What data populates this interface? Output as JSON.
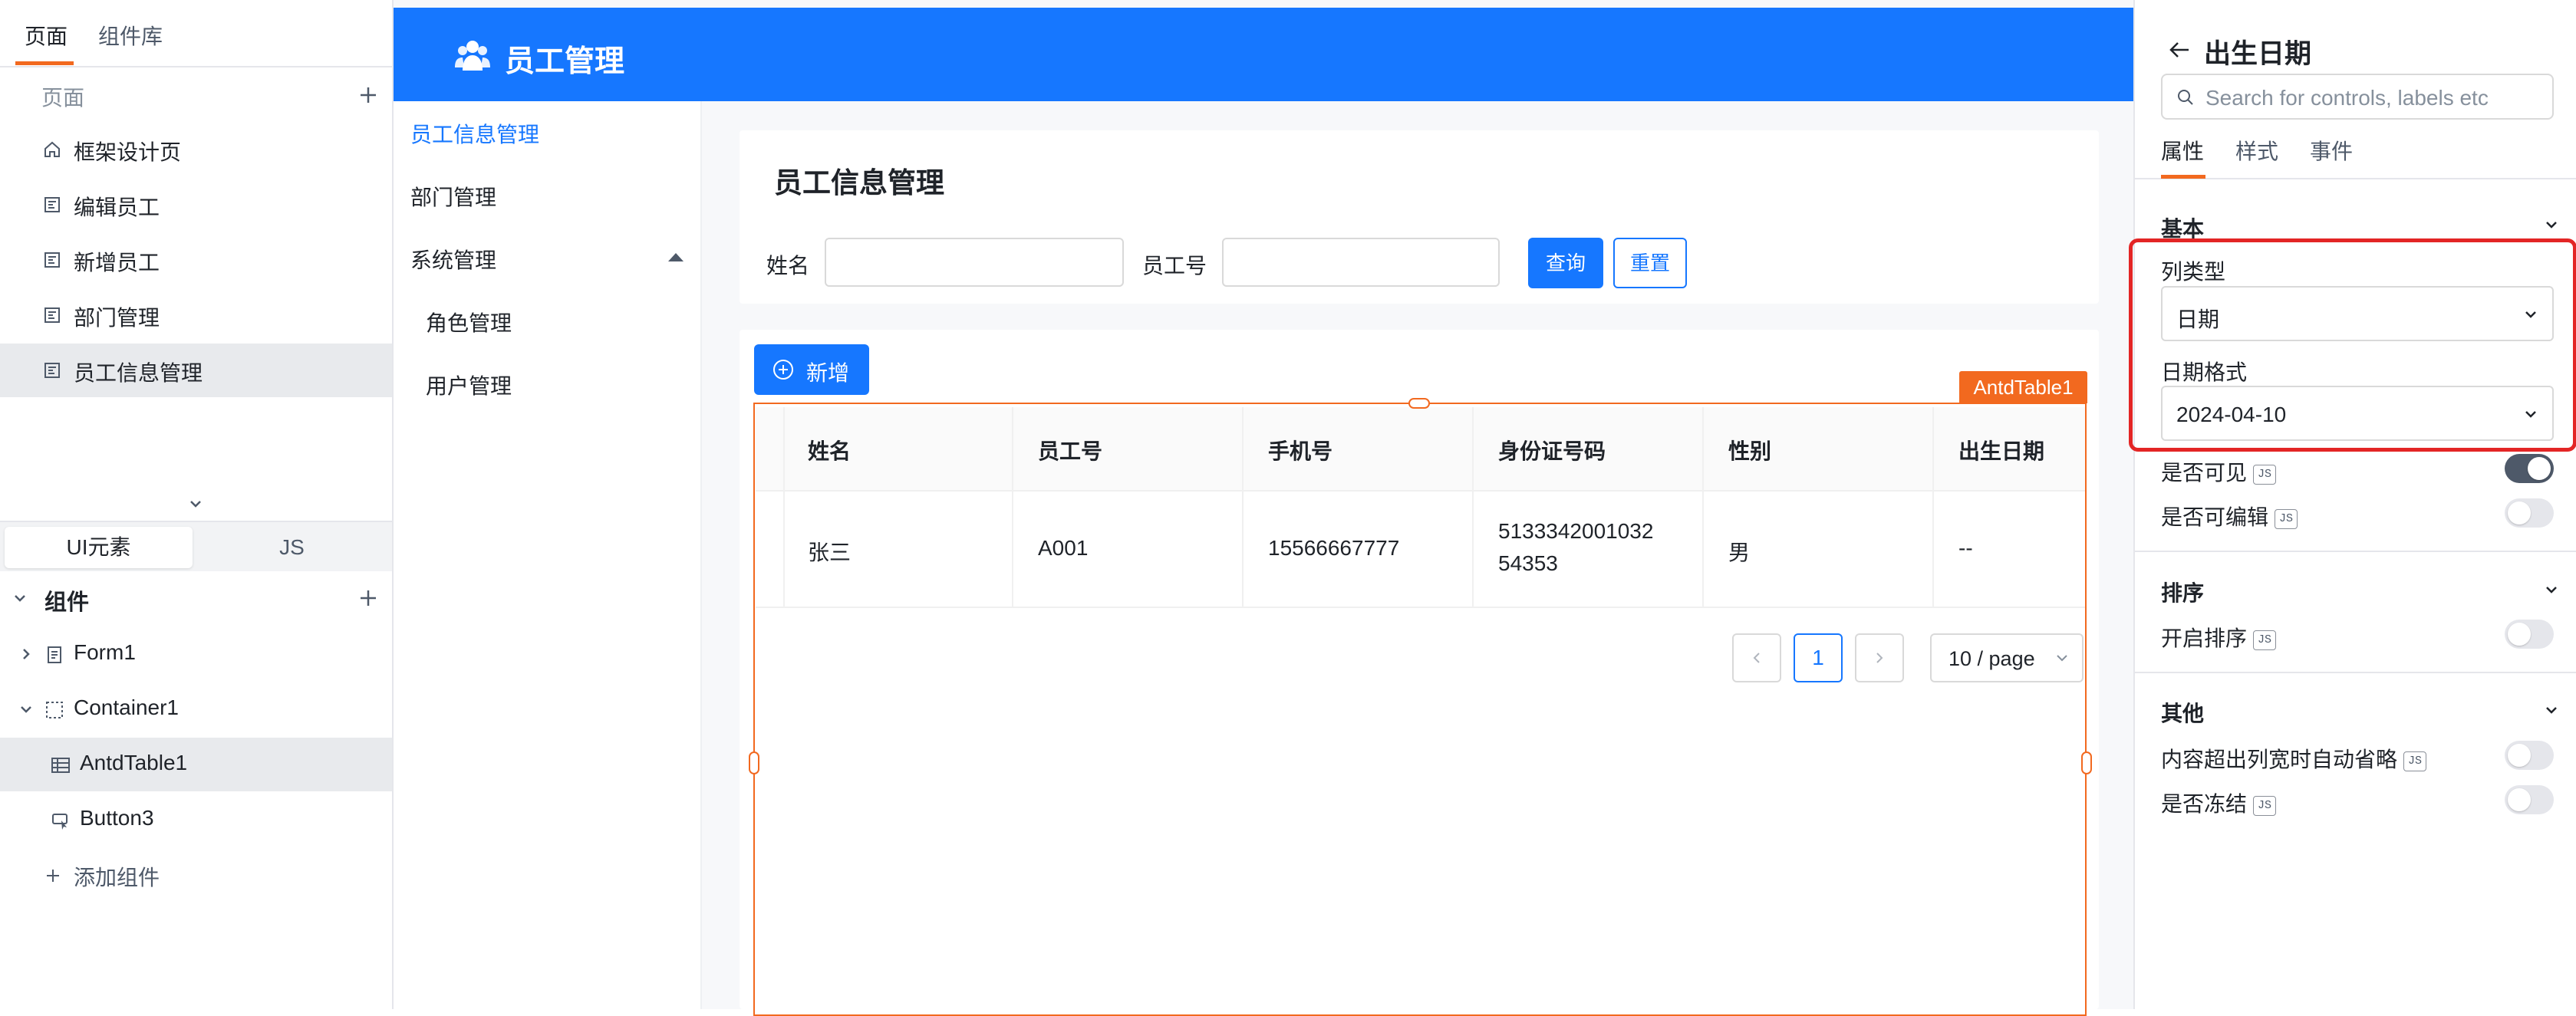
{
  "left": {
    "tabs": [
      "页面",
      "组件库"
    ],
    "pages_title": "页面",
    "pages": [
      "框架设计页",
      "编辑员工",
      "新增员工",
      "部门管理",
      "员工信息管理"
    ],
    "segment": [
      "UI元素",
      "JS"
    ],
    "components_title": "组件",
    "tree": [
      "Form1",
      "Container1",
      "AntdTable1",
      "Button3"
    ],
    "add_component": "添加组件"
  },
  "app": {
    "title": "员工管理",
    "menu": [
      "员工信息管理",
      "部门管理",
      "系统管理",
      "角色管理",
      "用户管理"
    ],
    "card_title": "员工信息管理",
    "form": {
      "name_label": "姓名",
      "empno_label": "员工号",
      "query": "查询",
      "reset": "重置"
    },
    "add_button": "新增",
    "selection_tag": "AntdTable1",
    "table": {
      "columns": [
        "姓名",
        "员工号",
        "手机号",
        "身份证号码",
        "性别",
        "出生日期"
      ],
      "row": {
        "name": "张三",
        "empno": "A001",
        "phone": "15566667777",
        "id_line1": "5133342001032",
        "id_line2": "54353",
        "gender": "男",
        "birth": "--"
      }
    },
    "pagination": {
      "current": "1",
      "page_size": "10 / page"
    }
  },
  "right": {
    "title": "出生日期",
    "search_placeholder": "Search for controls, labels etc",
    "tabs": [
      "属性",
      "样式",
      "事件"
    ],
    "groups": {
      "basic": "基本",
      "sort": "排序",
      "other": "其他"
    },
    "column_type_label": "列类型",
    "column_type_value": "日期",
    "date_format_label": "日期格式",
    "date_format_value": "2024-04-10",
    "visible_label": "是否可见",
    "editable_label": "是否可编辑",
    "sort_label": "开启排序",
    "ellipsis_label": "内容超出列宽时自动省略",
    "freeze_label": "是否冻结",
    "js_badge": "JS",
    "toggles": {
      "visible": true,
      "editable": false,
      "sort": false,
      "ellipsis": false,
      "freeze": false
    }
  },
  "colors": {
    "primary": "#1677ff",
    "accent": "#f2691f",
    "highlight": "#e32525"
  }
}
